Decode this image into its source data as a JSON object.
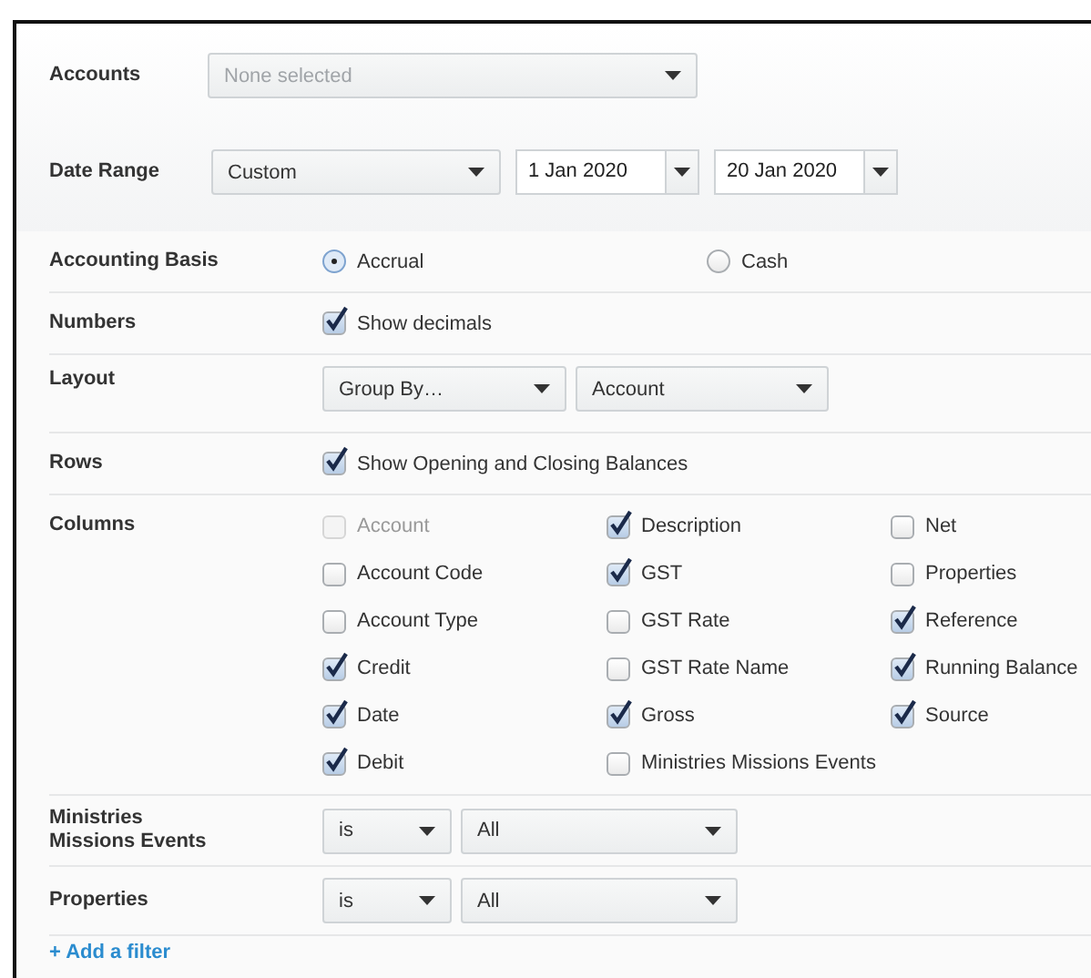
{
  "accounts": {
    "label": "Accounts",
    "placeholder": "None selected"
  },
  "date_range": {
    "label": "Date Range",
    "preset": "Custom",
    "from": "1 Jan 2020",
    "to": "20 Jan 2020"
  },
  "accounting_basis": {
    "label": "Accounting Basis",
    "options": [
      {
        "label": "Accrual",
        "selected": true
      },
      {
        "label": "Cash",
        "selected": false
      }
    ]
  },
  "numbers": {
    "label": "Numbers",
    "options": [
      {
        "label": "Show decimals",
        "checked": true
      }
    ]
  },
  "layout": {
    "label": "Layout",
    "selects": [
      "Group By…",
      "Account"
    ]
  },
  "rows": {
    "label": "Rows",
    "options": [
      {
        "label": "Show Opening and Closing Balances",
        "checked": true
      }
    ]
  },
  "columns": {
    "label": "Columns",
    "options": [
      {
        "label": "Account",
        "checked": false,
        "disabled": true
      },
      {
        "label": "Account Code",
        "checked": false,
        "disabled": false
      },
      {
        "label": "Account Type",
        "checked": false,
        "disabled": false
      },
      {
        "label": "Credit",
        "checked": true,
        "disabled": false
      },
      {
        "label": "Date",
        "checked": true,
        "disabled": false
      },
      {
        "label": "Debit",
        "checked": true,
        "disabled": false
      },
      {
        "label": "Description",
        "checked": true,
        "disabled": false
      },
      {
        "label": "GST",
        "checked": true,
        "disabled": false
      },
      {
        "label": "GST Rate",
        "checked": false,
        "disabled": false
      },
      {
        "label": "GST Rate Name",
        "checked": false,
        "disabled": false
      },
      {
        "label": "Gross",
        "checked": true,
        "disabled": false
      },
      {
        "label": "Ministries Missions Events",
        "checked": false,
        "disabled": false
      },
      {
        "label": "Net",
        "checked": false,
        "disabled": false
      },
      {
        "label": "Properties",
        "checked": false,
        "disabled": false
      },
      {
        "label": "Reference",
        "checked": true,
        "disabled": false
      },
      {
        "label": "Running Balance",
        "checked": true,
        "disabled": false
      },
      {
        "label": "Source",
        "checked": true,
        "disabled": false
      }
    ]
  },
  "filters": [
    {
      "label": "Ministries Missions Events",
      "operator": "is",
      "value": "All"
    },
    {
      "label": "Properties",
      "operator": "is",
      "value": "All"
    }
  ],
  "add_filter": "+ Add a filter"
}
